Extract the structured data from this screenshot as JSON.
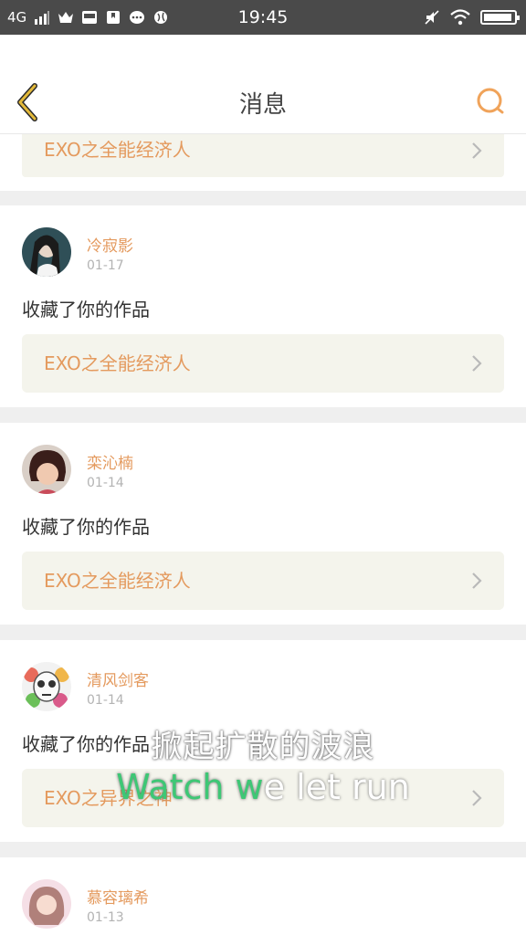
{
  "status_bar": {
    "network": "4G",
    "time": "19:45",
    "icons": [
      "signal-bars-icon",
      "crown-icon",
      "image-icon",
      "bookmark-icon",
      "chat-bubble-icon",
      "globe-icon",
      "mute-icon",
      "wifi-icon",
      "battery-icon"
    ]
  },
  "header": {
    "title": "消息",
    "back_icon": "chevron-left-icon",
    "search_icon": "search-icon"
  },
  "accent_color": "#e49a5e",
  "top_partial_item": {
    "work_title": "EXO之全能经济人"
  },
  "messages": [
    {
      "user": "冷寂影",
      "date": "01-17",
      "action": "收藏了你的作品",
      "work_title": "EXO之全能经济人"
    },
    {
      "user": "栾沁楠",
      "date": "01-14",
      "action": "收藏了你的作品",
      "work_title": "EXO之全能经济人"
    },
    {
      "user": "清风剑客",
      "date": "01-14",
      "action": "收藏了你的作品",
      "work_title": "EXO之异界之神"
    },
    {
      "user": "慕容璃希",
      "date": "01-13"
    }
  ],
  "subtitles": {
    "line1": "掀起扩散的波浪",
    "line2_highlight": "Watch w",
    "line2_rest": "e let run"
  }
}
